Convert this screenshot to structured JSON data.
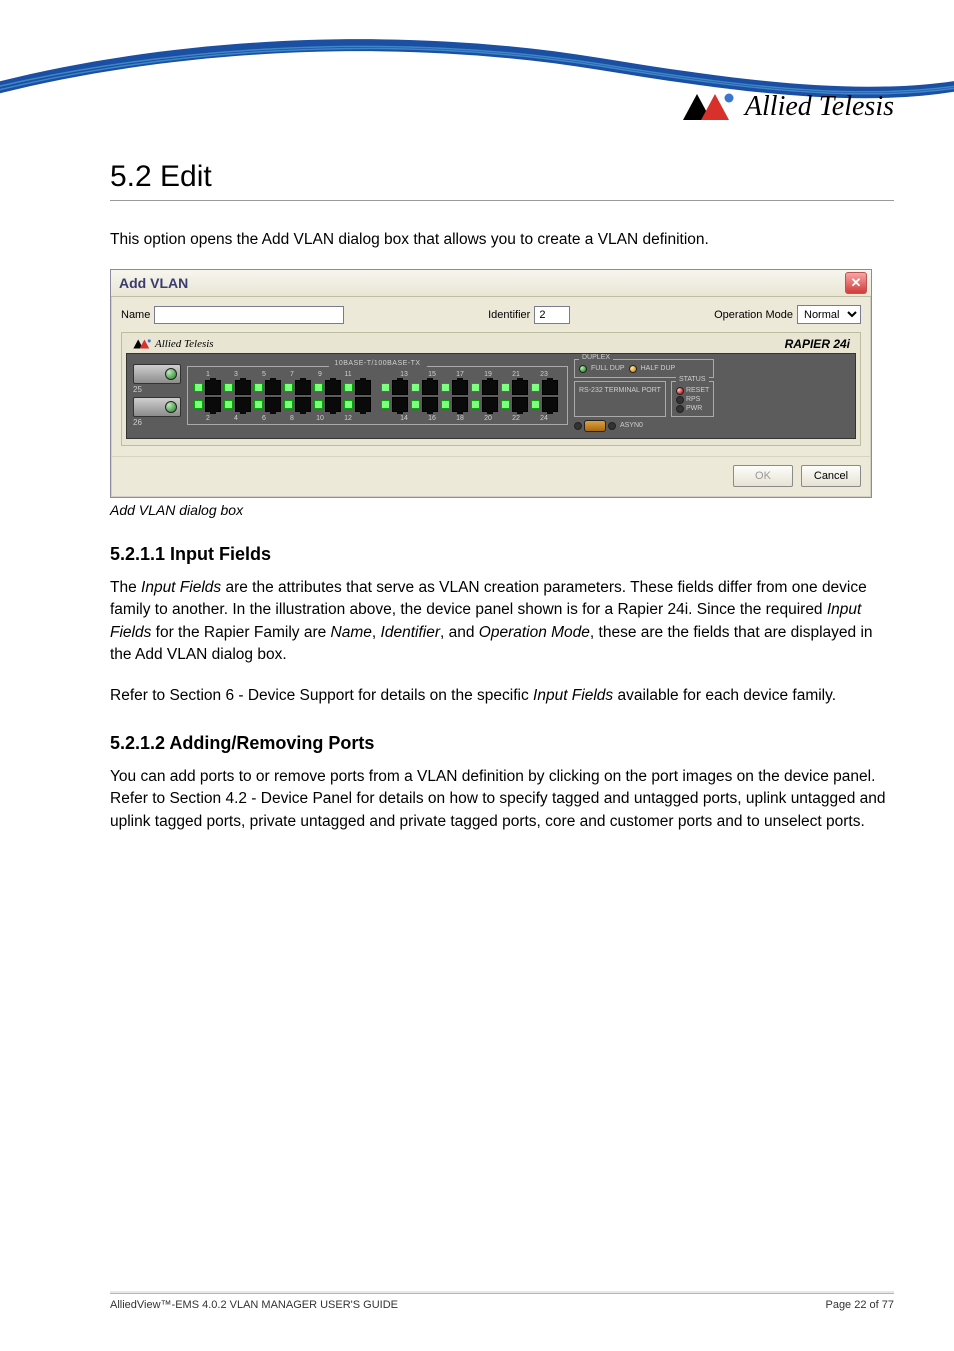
{
  "header": {
    "brand_text": "Allied Telesis"
  },
  "section": {
    "heading": "5.2 Edit",
    "intro": "This option opens the Add VLAN dialog box that allows you to create a VLAN definition."
  },
  "dialog": {
    "title": "Add VLAN",
    "fields": {
      "name_label": "Name",
      "name_value": "",
      "identifier_label": "Identifier",
      "identifier_value": "2",
      "opmode_label": "Operation Mode",
      "opmode_value": "Normal"
    },
    "device": {
      "brand": "Allied Telesis",
      "model": "RAPIER 24i",
      "port_block_label": "10BASE-T/100BASE-TX",
      "sfp_ports": [
        "25",
        "26"
      ],
      "top_row_ports": [
        "1",
        "3",
        "5",
        "7",
        "9",
        "11",
        "13",
        "15",
        "17",
        "19",
        "21",
        "23"
      ],
      "bottom_row_ports": [
        "2",
        "4",
        "6",
        "8",
        "10",
        "12",
        "14",
        "16",
        "18",
        "20",
        "22",
        "24"
      ],
      "duplex_label": "DUPLEX",
      "duplex_full": "FULL DUP",
      "duplex_half": "HALF DUP",
      "rs232_label": "RS-232 TERMINAL PORT",
      "status_label": "STATUS",
      "reset_label": "RESET",
      "rps_label": "RPS",
      "pwr_label": "PWR",
      "async_label": "ASYN0"
    },
    "buttons": {
      "ok": "OK",
      "cancel": "Cancel"
    }
  },
  "caption": "Add VLAN dialog box",
  "subsection1": {
    "heading": "5.2.1.1 Input Fields",
    "para1_part1": "The ",
    "para1_em1": "Input Fields",
    "para1_part2": " are the attributes that serve as VLAN creation parameters. These fields differ from one device family to another. In the illustration above, the device panel shown is for a Rapier 24i. Since the required ",
    "para1_em2": "Input Fields",
    "para1_part3": " for the Rapier Family are ",
    "para1_em3": "Name",
    "para1_part4": ", ",
    "para1_em4": "Identifier",
    "para1_part5": ", and ",
    "para1_em5": "Operation Mode",
    "para1_part6": ", these are the fields that are displayed in the Add VLAN dialog box.",
    "para2_part1": "Refer to Section 6 - Device Support for details on the specific ",
    "para2_em1": "Input Fields",
    "para2_part2": " available for each device family."
  },
  "subsection2": {
    "heading": "5.2.1.2 Adding/Removing Ports",
    "para": "You can add ports to or remove ports from a VLAN definition by clicking on the port images on the device panel. Refer to Section 4.2 - Device Panel for details on how to specify tagged and untagged ports, uplink untagged and uplink tagged ports, private untagged and private tagged ports, core and customer ports and to unselect ports."
  },
  "footer": {
    "left": "AlliedView™-EMS 4.0.2  VLAN MANAGER USER'S GUIDE",
    "right": "Page 22 of 77"
  }
}
